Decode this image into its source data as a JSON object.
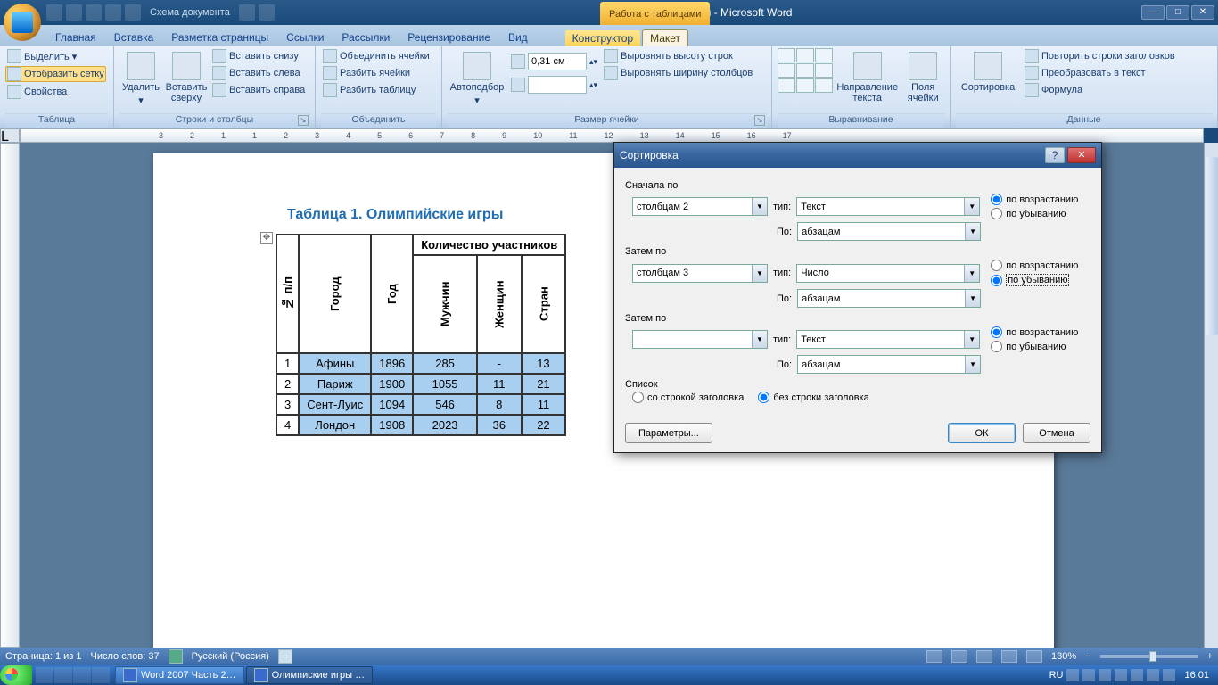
{
  "titlebar": {
    "qat_label": "Схема документа",
    "doc_title": "Олимписких игры - Microsoft Word",
    "context_title": "Работа с таблицами",
    "min": "—",
    "max": "□",
    "close": "✕"
  },
  "tabs": {
    "home": "Главная",
    "insert": "Вставка",
    "layout": "Разметка страницы",
    "refs": "Ссылки",
    "mail": "Рассылки",
    "review": "Рецензирование",
    "view": "Вид",
    "design": "Конструктор",
    "tlayout": "Макет"
  },
  "ribbon": {
    "g1": {
      "select": "Выделить ▾",
      "grid": "Отобразить сетку",
      "props": "Свойства",
      "label": "Таблица"
    },
    "g2": {
      "delete": "Удалить",
      "ins_top": "Вставить сверху",
      "ins_bottom": "Вставить снизу",
      "ins_left": "Вставить слева",
      "ins_right": "Вставить справа",
      "label": "Строки и столбцы"
    },
    "g3": {
      "merge": "Объединить ячейки",
      "split": "Разбить ячейки",
      "split_t": "Разбить таблицу",
      "label": "Объединить"
    },
    "g4": {
      "autofit": "Автоподбор",
      "h": "0,31 см",
      "w": "",
      "eq_h": "Выровнять высоту строк",
      "eq_w": "Выровнять ширину столбцов",
      "label": "Размер ячейки"
    },
    "g5": {
      "dir": "Направление текста",
      "marg": "Поля ячейки",
      "label": "Выравнивание"
    },
    "g6": {
      "sort": "Сортировка",
      "repeat": "Повторить строки заголовков",
      "convert": "Преобразовать в текст",
      "formula": "Формула",
      "label": "Данные"
    }
  },
  "ruler": {
    "m3": "3",
    "m2": "2",
    "m1": "1",
    "p1": "1",
    "p2": "2",
    "p3": "3",
    "p4": "4",
    "p5": "5",
    "p6": "6",
    "p7": "7",
    "p8": "8",
    "p9": "9",
    "p10": "10",
    "p11": "11",
    "p12": "12",
    "p13": "13",
    "p14": "14",
    "p15": "15",
    "p16": "16",
    "p17": "17"
  },
  "doc": {
    "title": "Таблица 1. Олимпийские игры",
    "handle": "✥",
    "th_group": "Количество участников",
    "th": {
      "n": "№ п/п",
      "city": "Город",
      "year": "Год",
      "m": "Мужчин",
      "w": "Женщин",
      "c": "Стран"
    },
    "rows": [
      {
        "n": "1",
        "city": "Афины",
        "year": "1896",
        "m": "285",
        "w": "-",
        "c": "13"
      },
      {
        "n": "2",
        "city": "Париж",
        "year": "1900",
        "m": "1055",
        "w": "11",
        "c": "21"
      },
      {
        "n": "3",
        "city": "Сент-Луис",
        "year": "1094",
        "m": "546",
        "w": "8",
        "c": "11"
      },
      {
        "n": "4",
        "city": "Лондон",
        "year": "1908",
        "m": "2023",
        "w": "36",
        "c": "22"
      }
    ]
  },
  "dialog": {
    "title": "Сортировка",
    "help": "?",
    "close": "✕",
    "first": "Сначала по",
    "first_col": "столбцам 2",
    "type_l": "тип:",
    "type_text": "Текст",
    "by_l": "По:",
    "by_para": "абзацам",
    "asc": "по возрастанию",
    "desc": "по убыванию",
    "then": "Затем по",
    "then1_col": "столбцам 3",
    "type_num": "Число",
    "then2_col": "",
    "list": "Список",
    "with_hdr": "со строкой заголовка",
    "no_hdr": "без строки заголовка",
    "params": "Параметры...",
    "ok": "ОК",
    "cancel": "Отмена"
  },
  "status": {
    "page": "Страница: 1 из 1",
    "words": "Число слов: 37",
    "lang": "Русский (Россия)",
    "zoom": "130%",
    "minus": "−",
    "plus": "+"
  },
  "taskbar": {
    "t1": "Word 2007 Часть 2…",
    "t2": "Олимпиские игры …",
    "lang": "RU",
    "time": "16:01"
  }
}
